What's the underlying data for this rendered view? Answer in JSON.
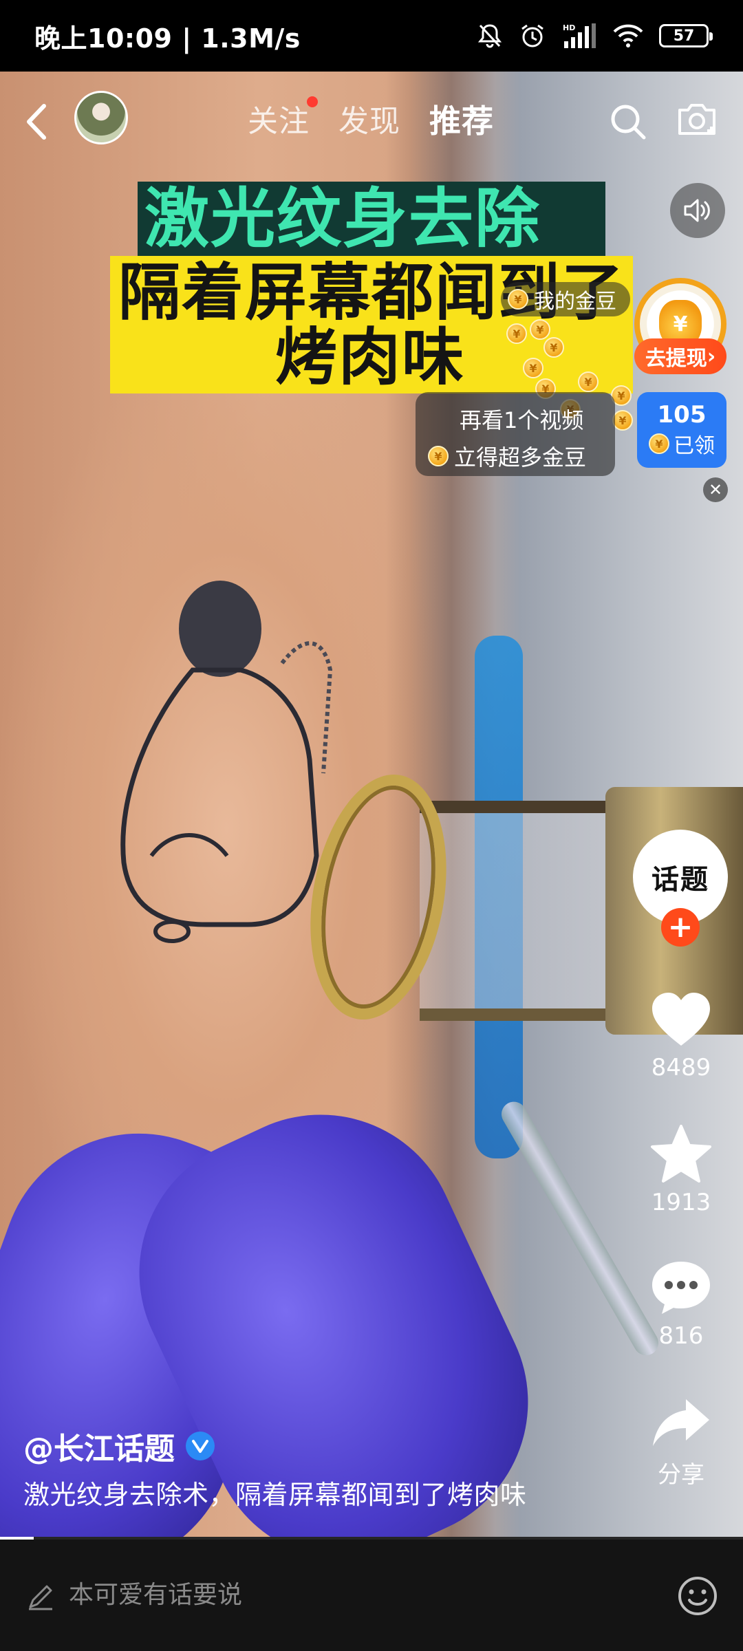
{
  "status_bar": {
    "time_speed": "晚上10:09 | 1.3M/s",
    "battery": "57"
  },
  "nav": {
    "tabs": [
      {
        "label": "关注",
        "has_dot": true
      },
      {
        "label": "发现",
        "has_dot": false
      },
      {
        "label": "推荐",
        "active": true
      }
    ]
  },
  "video_caption": {
    "line1": "激光纹身去除术",
    "line2a": "隔着屏幕都闻到了",
    "line2b": "烤肉味"
  },
  "gold_widget": {
    "label": "我的金豆",
    "withdraw": "去提现",
    "tip_line1": "再看1个视频",
    "tip_line2": "立得超多金豆",
    "claimed_count": "105",
    "claimed_label": "已领"
  },
  "creator": {
    "badge_text": "话题"
  },
  "actions": {
    "likes": "8489",
    "favorites": "1913",
    "comments": "816",
    "share": "分享"
  },
  "post": {
    "author": "@长江话题",
    "description": "激光纹身去除术，隔着屏幕都闻到了烤肉味"
  },
  "progress": 0.045,
  "comment_bar": {
    "placeholder": "本可爱有话要说"
  },
  "colors": {
    "accent_orange": "#ff4a1a",
    "accent_blue": "#2b7bf5",
    "caption_green": "#3fe6b0",
    "caption_yellow": "#f9e21a"
  }
}
